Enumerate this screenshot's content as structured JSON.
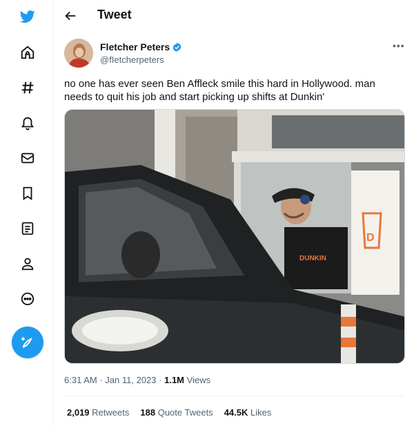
{
  "header": {
    "title": "Tweet"
  },
  "author": {
    "name": "Fletcher Peters",
    "handle": "@fIetcherpeters"
  },
  "tweet": {
    "text": "no one has ever seen Ben Affleck smile this hard in Hollywood. man needs to quit his job and start picking up shifts at Dunkin'",
    "time": "6:31 AM",
    "separator": "·",
    "date": "Jan 11, 2023",
    "separator2": "·",
    "views_count": "1.1M",
    "views_label": "Views"
  },
  "stats": {
    "retweets_count": "2,019",
    "retweets_label": "Retweets",
    "quotes_count": "188",
    "quotes_label": "Quote Tweets",
    "likes_count": "44.5K",
    "likes_label": "Likes"
  },
  "colors": {
    "accent": "#1d9bf0",
    "text": "#0f1419",
    "secondary": "#536471"
  },
  "icons": [
    "twitter-bird-icon",
    "home-icon",
    "hashtag-icon",
    "bell-icon",
    "mail-icon",
    "bookmark-icon",
    "list-icon",
    "profile-icon",
    "more-circle-icon",
    "compose-icon",
    "back-arrow-icon",
    "verified-badge-icon",
    "more-dots-icon"
  ]
}
